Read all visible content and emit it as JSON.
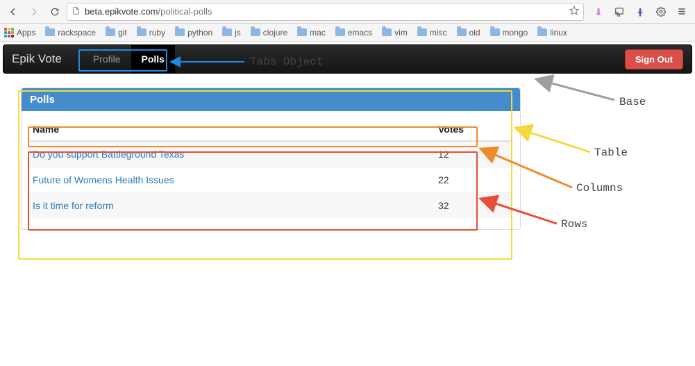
{
  "browser": {
    "url_host": "beta.epikvote.com",
    "url_path": "/political-polls",
    "bookmarks": {
      "apps_label": "Apps",
      "items": [
        "rackspace",
        "git",
        "ruby",
        "python",
        "js",
        "clojure",
        "mac",
        "emacs",
        "vim",
        "misc",
        "old",
        "mongo",
        "linux"
      ]
    }
  },
  "navbar": {
    "brand": "Epik Vote",
    "tabs": [
      {
        "label": "Profile",
        "active": false
      },
      {
        "label": "Polls",
        "active": true
      }
    ],
    "signout": "Sign Out"
  },
  "panel": {
    "title": "Polls"
  },
  "table": {
    "columns": {
      "name": "Name",
      "votes": "Votes"
    },
    "rows": [
      {
        "name": "Do you support Battleground Texas",
        "votes": "12"
      },
      {
        "name": "Future of Womens Health Issues",
        "votes": "22"
      },
      {
        "name": "Is it time for reform",
        "votes": "32"
      }
    ]
  },
  "annotations": {
    "tabs": "Tabs Object",
    "base": "Base",
    "table": "Table",
    "columns": "Columns",
    "rows": "Rows"
  },
  "chart_data": {
    "type": "table",
    "title": "Polls",
    "columns": [
      "Name",
      "Votes"
    ],
    "rows": [
      [
        "Do you support Battleground Texas",
        12
      ],
      [
        "Future of Womens Health Issues",
        22
      ],
      [
        "Is it time for reform",
        32
      ]
    ]
  }
}
